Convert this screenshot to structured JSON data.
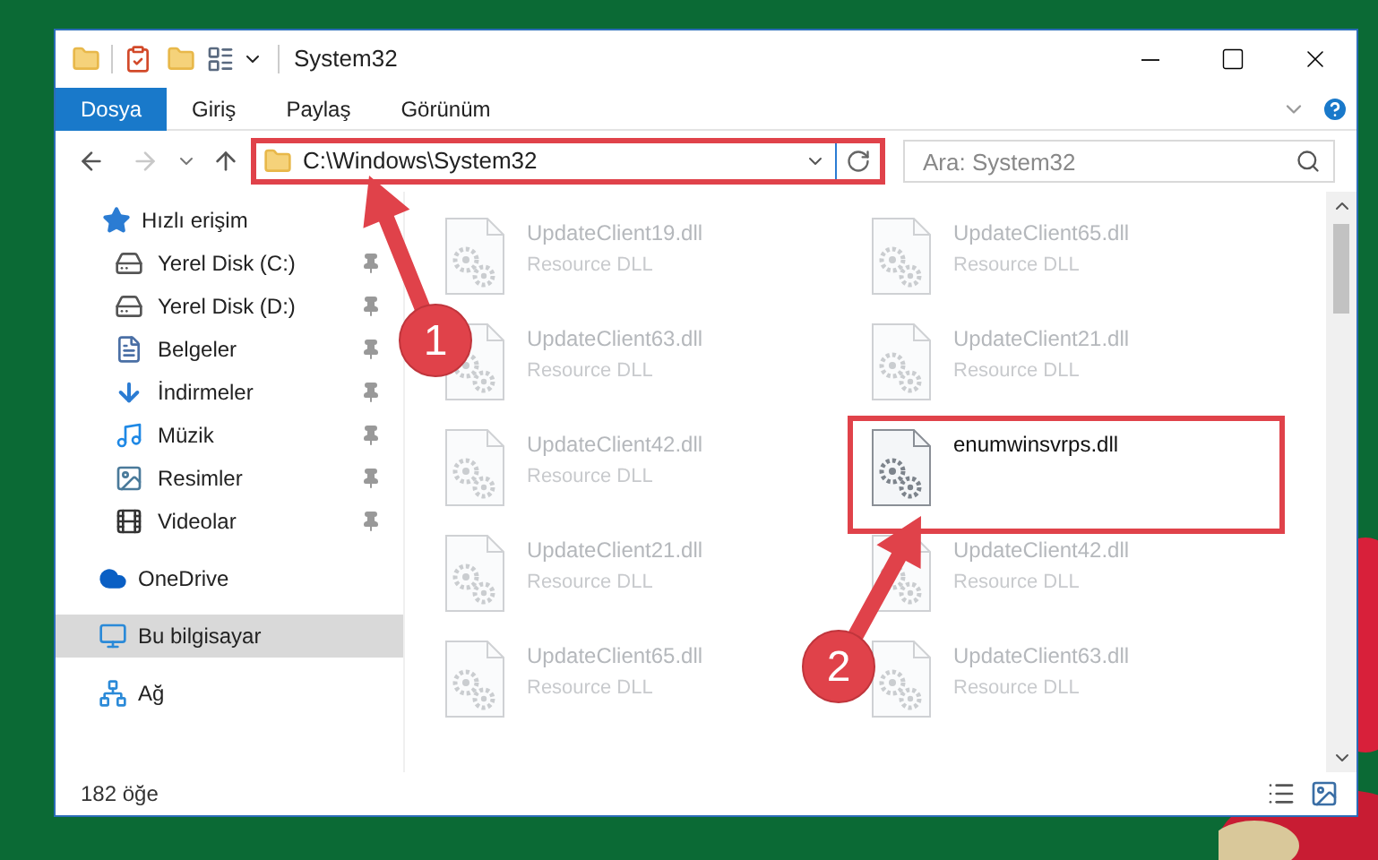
{
  "window": {
    "title": "System32"
  },
  "ribbon_tabs": [
    {
      "label": "Dosya",
      "selected": true
    },
    {
      "label": "Giriş",
      "selected": false
    },
    {
      "label": "Paylaş",
      "selected": false
    },
    {
      "label": "Görünüm",
      "selected": false
    }
  ],
  "address_bar": {
    "path": "C:\\Windows\\System32",
    "highlighted": true
  },
  "search": {
    "placeholder": "Ara: System32"
  },
  "nav_pane": [
    {
      "label": "Hızlı erişim",
      "kind": "quick",
      "selected": false,
      "children": [
        {
          "label": "Yerel Disk (C:)",
          "kind": "system-drive",
          "pinned": true
        },
        {
          "label": "Yerel Disk (D:)",
          "kind": "drive",
          "pinned": true
        },
        {
          "label": "Belgeler",
          "kind": "documents",
          "pinned": true
        },
        {
          "label": "İndirmeler",
          "kind": "downloads",
          "pinned": true
        },
        {
          "label": "Müzik",
          "kind": "music",
          "pinned": true
        },
        {
          "label": "Resimler",
          "kind": "pictures",
          "pinned": true
        },
        {
          "label": "Videolar",
          "kind": "videos",
          "pinned": true
        }
      ]
    },
    {
      "label": "OneDrive",
      "kind": "cloud",
      "selected": false
    },
    {
      "label": "Bu bilgisayar",
      "kind": "computer",
      "selected": true
    },
    {
      "label": "Ağ",
      "kind": "network",
      "selected": false
    }
  ],
  "files": [
    {
      "name": "UpdateClient19.dll",
      "type": "Resource DLL",
      "blurred": true,
      "highlighted": false
    },
    {
      "name": "UpdateClient65.dll",
      "type": "Resource DLL",
      "blurred": true,
      "highlighted": false
    },
    {
      "name": "UpdateClient63.dll",
      "type": "Resource DLL",
      "blurred": true,
      "highlighted": false
    },
    {
      "name": "UpdateClient21.dll",
      "type": "Resource DLL",
      "blurred": true,
      "highlighted": false
    },
    {
      "name": "UpdateClient42.dll",
      "type": "Resource DLL",
      "blurred": true,
      "highlighted": false
    },
    {
      "name": "enumwinsvrps.dll",
      "blurred": false,
      "highlighted": true
    },
    {
      "name": "UpdateClient21.dll",
      "type": "Resource DLL",
      "blurred": true,
      "highlighted": false
    },
    {
      "name": "UpdateClient42.dll",
      "type": "Resource DLL",
      "blurred": true,
      "highlighted": false
    },
    {
      "name": "UpdateClient65.dll",
      "type": "Resource DLL",
      "blurred": true,
      "highlighted": false
    },
    {
      "name": "UpdateClient63.dll",
      "type": "Resource DLL",
      "blurred": true,
      "highlighted": false
    }
  ],
  "status_bar": {
    "count": "182 öğe"
  },
  "annotations": [
    {
      "label": "1"
    },
    {
      "label": "2"
    }
  ]
}
